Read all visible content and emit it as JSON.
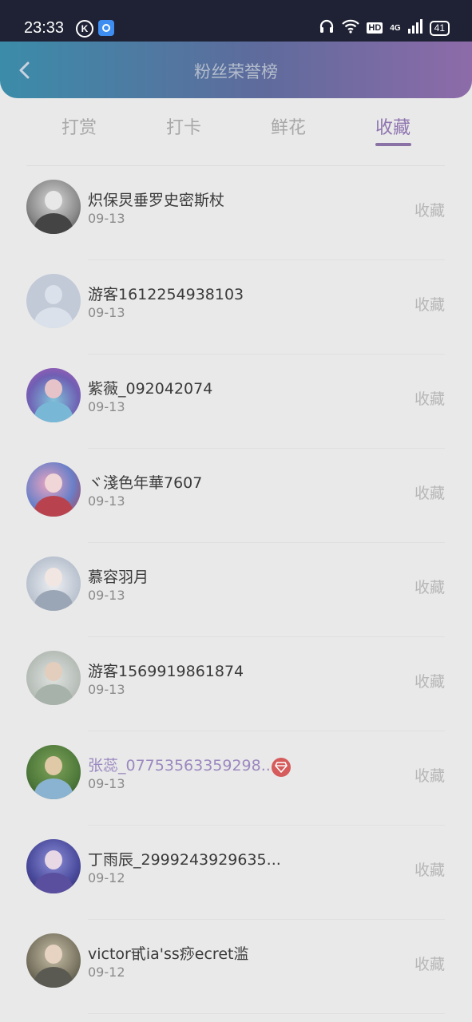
{
  "status_bar": {
    "time": "23:33",
    "network": "4G",
    "hd": "HD",
    "battery": "41"
  },
  "header": {
    "title": "粉丝荣誉榜"
  },
  "tabs": [
    {
      "label": "打赏"
    },
    {
      "label": "打卡"
    },
    {
      "label": "鲜花"
    },
    {
      "label": "收藏"
    }
  ],
  "active_tab": "收藏",
  "fans": [
    {
      "name": "炽保炅垂罗史密斯杖",
      "date": "09-13",
      "action": "收藏"
    },
    {
      "name": "游客1612254938103",
      "date": "09-13",
      "action": "收藏"
    },
    {
      "name": "紫薇_092042074",
      "date": "09-13",
      "action": "收藏"
    },
    {
      "name": "ヾ淺色年華7607",
      "date": "09-13",
      "action": "收藏"
    },
    {
      "name": "慕容羽月",
      "date": "09-13",
      "action": "收藏"
    },
    {
      "name": "游客1569919861874",
      "date": "09-13",
      "action": "收藏"
    },
    {
      "name": "张蕊_07753563359298...",
      "date": "09-13",
      "action": "收藏",
      "vip": true
    },
    {
      "name": "丁雨辰_2999243929635...",
      "date": "09-12",
      "action": "收藏"
    },
    {
      "name": "victor甙ia'ss痧ecret滥",
      "date": "09-12",
      "action": "收藏"
    }
  ],
  "colors": {
    "accent": "#8a72a6",
    "header_start": "#3b8ca9",
    "header_end": "#8d6ba9"
  }
}
